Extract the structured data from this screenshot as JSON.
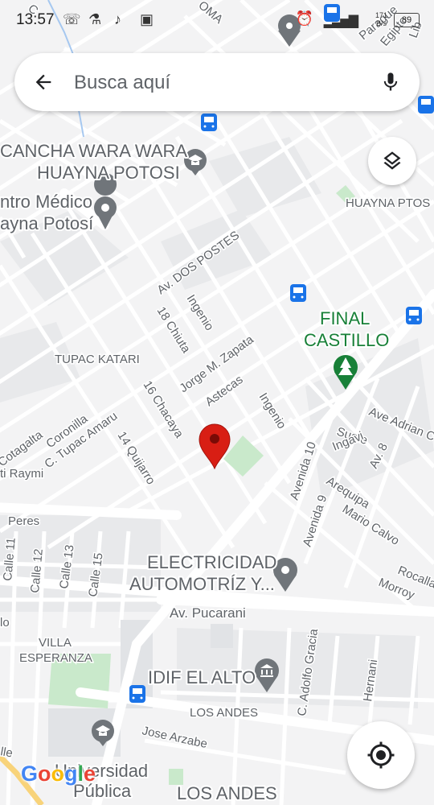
{
  "status_bar": {
    "time": "13:57",
    "net_speed": "171\nB/s",
    "battery": "89",
    "icons": [
      "whatsapp-icon",
      "flask-icon",
      "tiktok-icon",
      "laptop-icon",
      "alarm-icon",
      "wifi-icon",
      "signal-icon",
      "battery-icon"
    ]
  },
  "search": {
    "placeholder": "Busca aquí",
    "back_icon": "arrow-left-icon",
    "mic_icon": "microphone-icon"
  },
  "buttons": {
    "layers_icon": "layers-icon",
    "locate_icon": "my-location-icon"
  },
  "logo": {
    "letters": [
      "G",
      "o",
      "o",
      "g",
      "l",
      "e"
    ],
    "colors": [
      "#4285F4",
      "#EA4335",
      "#FBBC05",
      "#4285F4",
      "#34A853",
      "#EA4335"
    ]
  },
  "colors": {
    "map_background": "#f3f3f4",
    "road": "#ffffff",
    "park": "#c9e9cb",
    "poi_gray": "#70757a",
    "poi_green": "#188038",
    "transit_blue": "#1a73e8",
    "pin_red": "#d81e14"
  },
  "map": {
    "poi_labels": [
      {
        "text": "CANCHA WARA WARA",
        "style": "poi"
      },
      {
        "text": "HUAYNA POTOSI",
        "style": "poi"
      },
      {
        "text": "ntro Médico",
        "style": "poi"
      },
      {
        "text": "ayna Potosí",
        "style": "poi"
      },
      {
        "text": "FINAL",
        "style": "green"
      },
      {
        "text": "CASTILLO",
        "style": "green"
      },
      {
        "text": "ELECTRICIDAD",
        "style": "poi"
      },
      {
        "text": "AUTOMOTRÍZ Y...",
        "style": "poi"
      },
      {
        "text": "IDIF EL ALTO",
        "style": "poi"
      },
      {
        "text": "Universidad",
        "style": "poi"
      },
      {
        "text": "Pública",
        "style": "poi"
      },
      {
        "text": "LOS ANDES",
        "style": "poi"
      }
    ],
    "area_labels": [
      "HUAYNA PTOS",
      "TUPAC KATARI",
      "VILLA",
      "ESPERANZA",
      "LOS ANDES"
    ],
    "street_labels": [
      "Av. DOS POSTES",
      "Ingenio",
      "18 Chiuta",
      "Jorge M. Zapata",
      "Astecas",
      "Ingenio",
      "16 Chacaya",
      "C. Tupac Amaru",
      "Coronilla",
      "Cotagalta",
      "14 Quijarro",
      "ti Raymi",
      "Peres",
      "Ave Adrian C",
      "Sucre",
      "Ingavi",
      "Av. 8",
      "Avenida 10",
      "Arequipa",
      "Mario Calvo",
      "Avenida 9",
      "Rocalla",
      "Morroy",
      "Av. Pucarani",
      "Calle 11",
      "Calle 12",
      "Calle 13",
      "Calle 15",
      "C. Adolfo Gracia",
      "Hernani",
      "Jose Arzabe",
      "lle",
      "lo",
      "Parague",
      "Egipto",
      "Lib",
      "OMA",
      "C"
    ]
  }
}
